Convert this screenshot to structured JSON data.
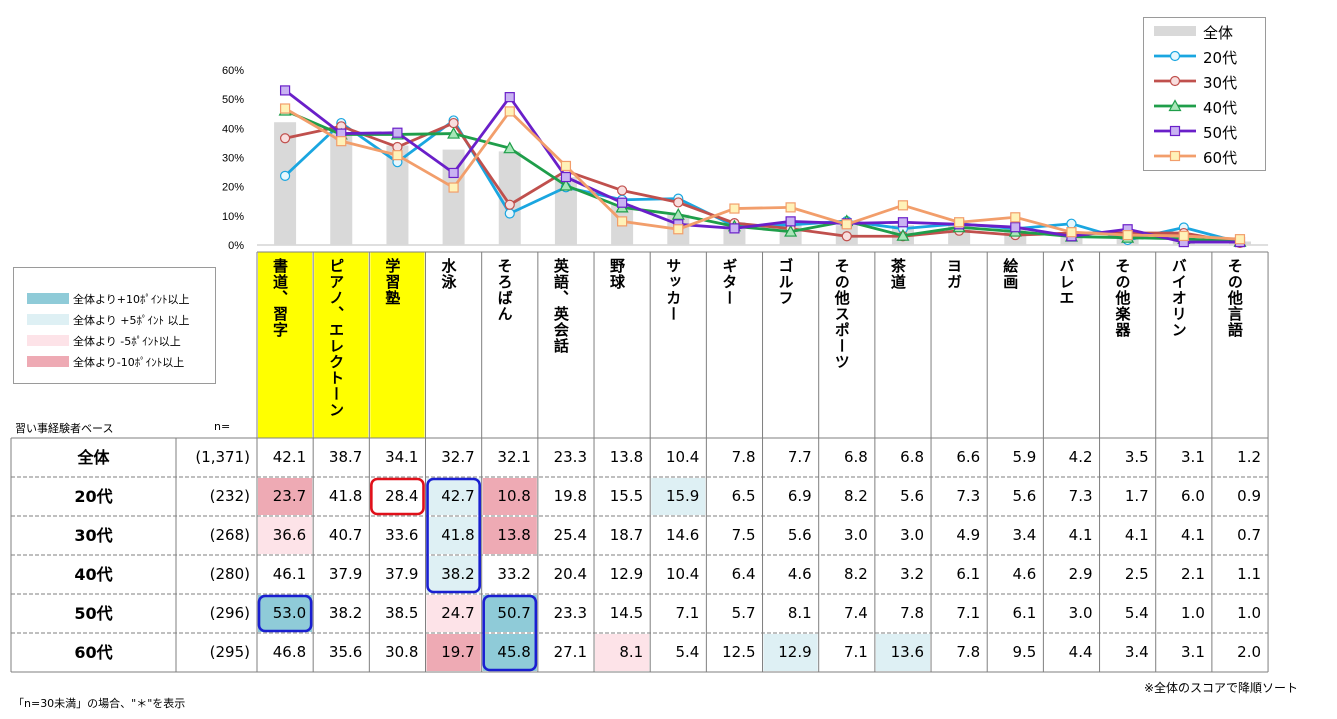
{
  "chart_data": {
    "type": "table",
    "y_axis_ticks": [
      "0%",
      "10%",
      "20%",
      "30%",
      "40%",
      "50%",
      "60%"
    ],
    "ylim": [
      0,
      60
    ],
    "categories": [
      "書道、習字",
      "ピアノ、エレクトーン",
      "学習塾",
      "水泳",
      "そろばん",
      "英語、英会話",
      "野球",
      "サッカー",
      "ギター",
      "ゴルフ",
      "その他スポーツ",
      "茶道",
      "ヨガ",
      "絵画",
      "バレエ",
      "その他楽器",
      "バイオリン",
      "その他言語"
    ],
    "base_label": "習い事経験者ベース",
    "n_header": "n=",
    "rows": [
      {
        "name": "全体",
        "n": "(1,371)",
        "values": [
          42.1,
          38.7,
          34.1,
          32.7,
          32.1,
          23.3,
          13.8,
          10.4,
          7.8,
          7.7,
          6.8,
          6.8,
          6.6,
          5.9,
          4.2,
          3.5,
          3.1,
          1.2
        ],
        "shade": [
          "",
          "",
          "",
          "",
          "",
          "",
          "",
          "",
          "",
          "",
          "",
          "",
          "",
          "",
          "",
          "",
          "",
          ""
        ]
      },
      {
        "name": "20代",
        "n": "(232)",
        "values": [
          23.7,
          41.8,
          28.4,
          42.7,
          10.8,
          19.8,
          15.5,
          15.9,
          6.5,
          6.9,
          8.2,
          5.6,
          7.3,
          5.6,
          7.3,
          1.7,
          6.0,
          0.9
        ],
        "shade": [
          "m10",
          "",
          "",
          "p5",
          "m10",
          "",
          "",
          "p5",
          "",
          "",
          "",
          "",
          "",
          "",
          "",
          "",
          "",
          ""
        ]
      },
      {
        "name": "30代",
        "n": "(268)",
        "values": [
          36.6,
          40.7,
          33.6,
          41.8,
          13.8,
          25.4,
          18.7,
          14.6,
          7.5,
          5.6,
          3.0,
          3.0,
          4.9,
          3.4,
          4.1,
          4.1,
          4.1,
          0.7
        ],
        "shade": [
          "m5",
          "",
          "",
          "p5",
          "m10",
          "",
          "",
          "",
          "",
          "",
          "",
          "",
          "",
          "",
          "",
          "",
          "",
          ""
        ]
      },
      {
        "name": "40代",
        "n": "(280)",
        "values": [
          46.1,
          37.9,
          37.9,
          38.2,
          33.2,
          20.4,
          12.9,
          10.4,
          6.4,
          4.6,
          8.2,
          3.2,
          6.1,
          4.6,
          2.9,
          2.5,
          2.1,
          1.1
        ],
        "shade": [
          "",
          "",
          "",
          "p5",
          "",
          "",
          "",
          "",
          "",
          "",
          "",
          "",
          "",
          "",
          "",
          "",
          "",
          ""
        ]
      },
      {
        "name": "50代",
        "n": "(296)",
        "values": [
          53.0,
          38.2,
          38.5,
          24.7,
          50.7,
          23.3,
          14.5,
          7.1,
          5.7,
          8.1,
          7.4,
          7.8,
          7.1,
          6.1,
          3.0,
          5.4,
          1.0,
          1.0
        ],
        "shade": [
          "p10",
          "",
          "",
          "m5",
          "p10",
          "",
          "",
          "",
          "",
          "",
          "",
          "",
          "",
          "",
          "",
          "",
          "",
          ""
        ]
      },
      {
        "name": "60代",
        "n": "(295)",
        "values": [
          46.8,
          35.6,
          30.8,
          19.7,
          45.8,
          27.1,
          8.1,
          5.4,
          12.5,
          12.9,
          7.1,
          13.6,
          7.8,
          9.5,
          4.4,
          3.4,
          3.1,
          2.0
        ],
        "shade": [
          "",
          "",
          "",
          "m10",
          "p10",
          "",
          "m5",
          "",
          "",
          "p5",
          "",
          "p5",
          "",
          "",
          "",
          "",
          "",
          ""
        ]
      }
    ],
    "series_colors": {
      "全体": "#d9d9d9",
      "20代": "#1aa6e0",
      "30代": "#c0504d",
      "40代": "#1f9e4a",
      "50代": "#6a1fc9",
      "60代": "#f29e6b"
    },
    "marker_fills": {
      "20代": "#e6f7fd",
      "30代": "#f8dede",
      "40代": "#a8e6b8",
      "50代": "#c9b3f2",
      "60代": "#fff2b8"
    },
    "colors": {
      "p10": "#8fcbd8",
      "p5": "#def0f4",
      "m5": "#fde3e8",
      "m10": "#eeaab4",
      "yellow": "#ffff00"
    },
    "legend": [
      {
        "label": "全体",
        "kind": "bar"
      },
      {
        "label": "20代",
        "kind": "circle"
      },
      {
        "label": "30代",
        "kind": "circle"
      },
      {
        "label": "40代",
        "kind": "triangle"
      },
      {
        "label": "50代",
        "kind": "square"
      },
      {
        "label": "60代",
        "kind": "square"
      }
    ],
    "highlight_legend": [
      {
        "label": "全体より+10ﾎﾟｲﾝﾄ以上",
        "key": "p10"
      },
      {
        "label": "全体より +5ﾎﾟｲﾝﾄ 以上",
        "key": "p5"
      },
      {
        "label": "全体より -5ﾎﾟｲﾝﾄ以上",
        "key": "m5"
      },
      {
        "label": "全体より-10ﾎﾟｲﾝﾄ以上",
        "key": "m10"
      }
    ],
    "yellow_categories": [
      0,
      1,
      2
    ]
  },
  "notes": {
    "left": "「n=30未満」の場合、\"＊\"を表示",
    "right": "※全体のスコアで降順ソート"
  }
}
